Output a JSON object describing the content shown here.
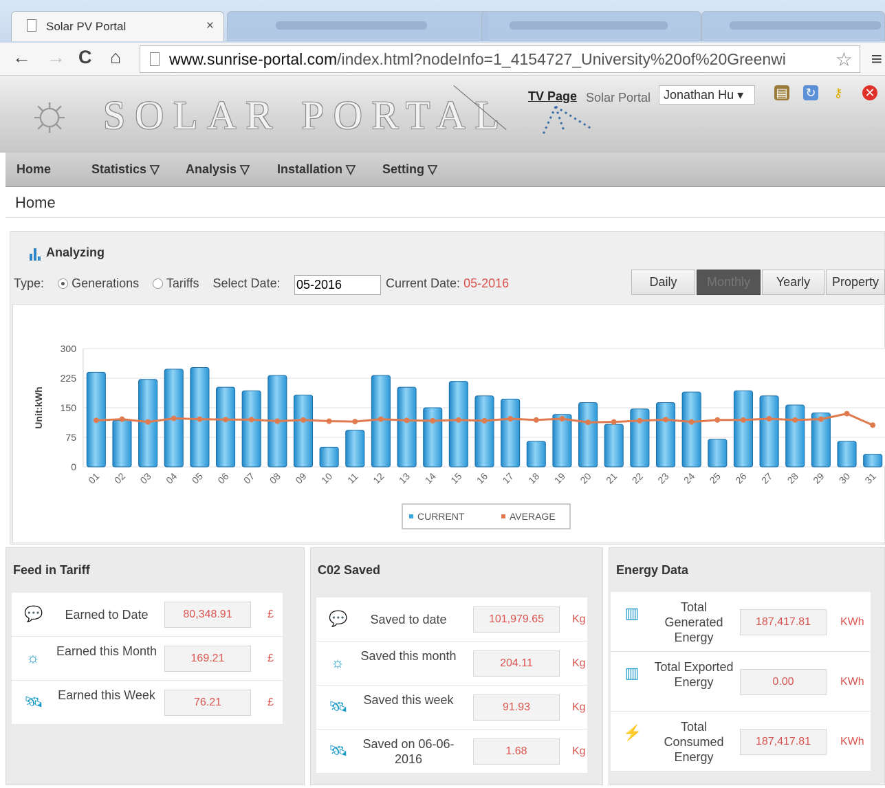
{
  "browser": {
    "tab_title": "Solar PV Portal",
    "tab_close": "×",
    "url_domain": "www.sunrise-portal.com",
    "url_path": "/index.html?nodeInfo=1_4154727_University%20of%20Greenwi"
  },
  "header": {
    "logo_text": "SOLAR PORTAL",
    "tv_page": "TV Page",
    "portal_label": "Solar Portal",
    "user_select": "Jonathan Hu ▾"
  },
  "nav": {
    "home": "Home",
    "statistics": "Statistics ▽",
    "analysis": "Analysis ▽",
    "installation": "Installation ▽",
    "setting": "Setting ▽"
  },
  "breadcrumb": "Home",
  "analyzing": {
    "title": "Analyzing",
    "type_label": "Type:",
    "generations": "Generations",
    "tariffs": "Tariffs",
    "select_date_label": "Select Date:",
    "select_date_value": "05-2016",
    "current_date_label": "Current Date:",
    "current_date_value": "05-2016",
    "buttons": {
      "daily": "Daily",
      "monthly": "Monthly",
      "yearly": "Yearly",
      "property": "Property"
    }
  },
  "chart_data": {
    "type": "bar",
    "ylabel": "Unit:kWh",
    "ylim": [
      0,
      300
    ],
    "yticks": [
      0,
      75,
      150,
      225,
      300
    ],
    "categories": [
      "01",
      "02",
      "03",
      "04",
      "05",
      "06",
      "07",
      "08",
      "09",
      "10",
      "11",
      "12",
      "13",
      "14",
      "15",
      "16",
      "17",
      "18",
      "19",
      "20",
      "21",
      "22",
      "23",
      "24",
      "25",
      "26",
      "27",
      "28",
      "29",
      "30",
      "31"
    ],
    "series": [
      {
        "name": "CURRENT",
        "type": "bar",
        "color": "#3aa6e0",
        "values": [
          240,
          118,
          222,
          248,
          252,
          202,
          193,
          232,
          182,
          50,
          93,
          232,
          202,
          150,
          217,
          180,
          172,
          65,
          133,
          163,
          108,
          147,
          163,
          190,
          70,
          193,
          180,
          157,
          137,
          65,
          32
        ]
      },
      {
        "name": "AVERAGE",
        "type": "line",
        "color": "#e07b4f",
        "values": [
          118,
          121,
          114,
          123,
          121,
          120,
          120,
          116,
          119,
          116,
          115,
          121,
          118,
          117,
          119,
          117,
          122,
          119,
          122,
          113,
          114,
          117,
          120,
          114,
          119,
          119,
          122,
          119,
          121,
          135,
          106
        ]
      }
    ],
    "legend": "bottom-center"
  },
  "feed_in_tariff": {
    "title": "Feed in Tariff",
    "rows": [
      {
        "label": "Earned to Date",
        "value": "80,348.91",
        "unit": "£"
      },
      {
        "label": "Earned this Month",
        "value": "169.21",
        "unit": "£"
      },
      {
        "label": "Earned this Week",
        "value": "76.21",
        "unit": "£"
      }
    ]
  },
  "co2_saved": {
    "title": "C02 Saved",
    "rows": [
      {
        "label": "Saved to date",
        "value": "101,979.65",
        "unit": "Kg"
      },
      {
        "label": "Saved this month",
        "value": "204.11",
        "unit": "Kg"
      },
      {
        "label": "Saved this week",
        "value": "91.93",
        "unit": "Kg"
      },
      {
        "label": "Saved on 06-06-2016",
        "value": "1.68",
        "unit": "Kg"
      }
    ]
  },
  "energy_data": {
    "title": "Energy Data",
    "rows": [
      {
        "label": "Total Generated Energy",
        "value": "187,417.81",
        "unit": "KWh"
      },
      {
        "label": "Total Exported Energy",
        "value": "0.00",
        "unit": "KWh"
      },
      {
        "label": "Total Consumed Energy",
        "value": "187,417.81",
        "unit": "KWh"
      }
    ]
  }
}
